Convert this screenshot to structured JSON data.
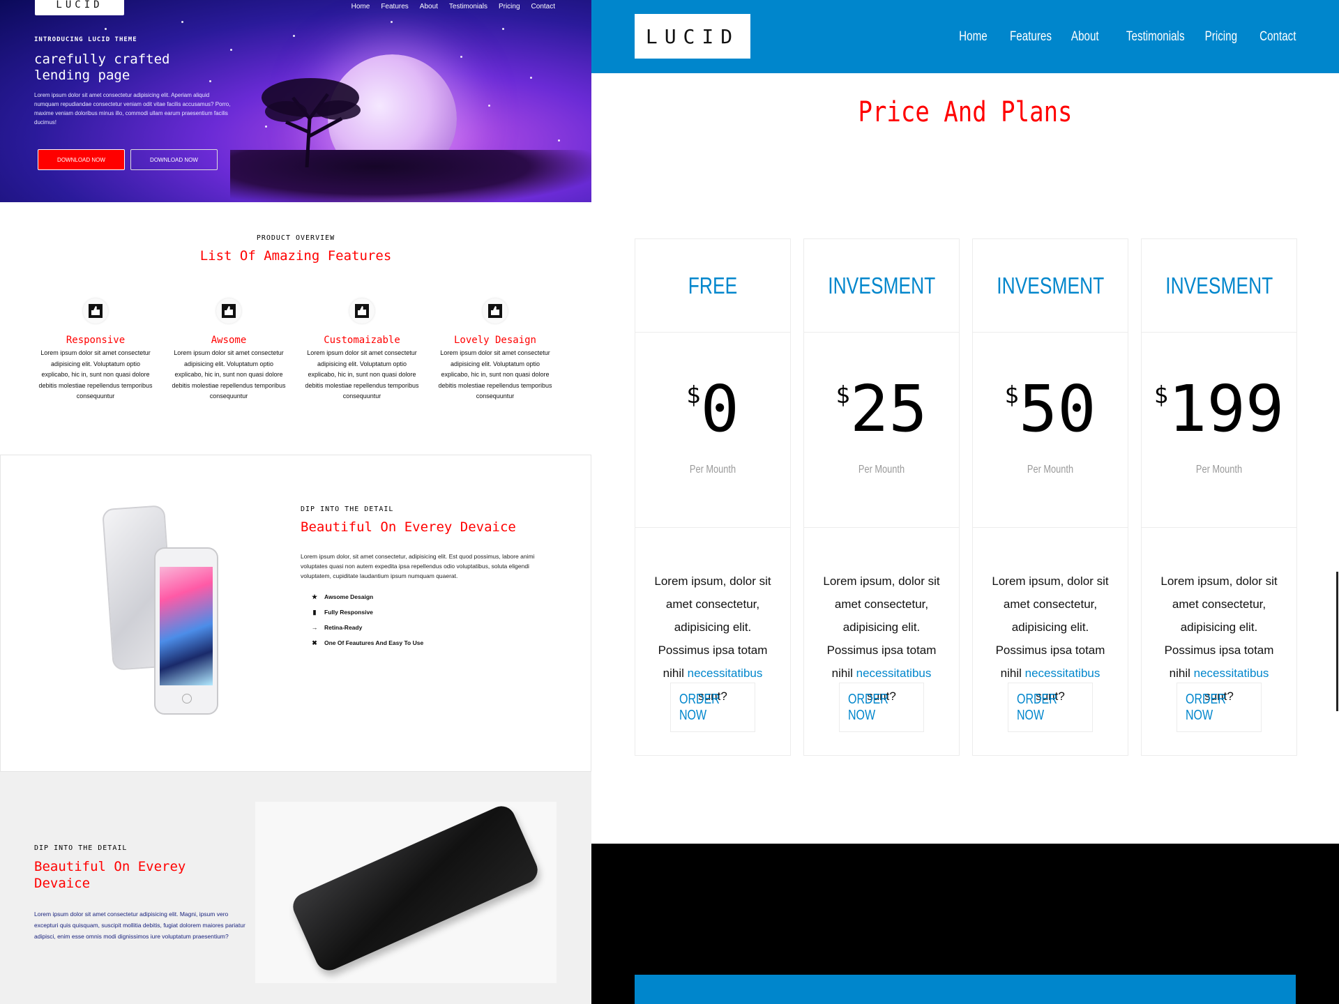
{
  "left": {
    "hero": {
      "logo": "LUCID",
      "nav": [
        "Home",
        "Features",
        "About",
        "Testimonials",
        "Pricing",
        "Contact"
      ],
      "kicker": "INTRODUCING LUCID THEME",
      "title": "carefully crafted lending page",
      "text": "Lorem ipsum dolor sit amet consectetur adipisicing elit. Aperiam aliquid numquam repudiandae consectetur veniam odit vitae facilis accusamus? Porro, maxime veniam doloribus minus illo, commodi ullam earum praesentium facilis ducimus!",
      "button1": "DOWNLOAD NOW",
      "button2": "DOWNLOAD NOW"
    },
    "features": {
      "kicker": "PRODUCT OVERVIEW",
      "title": "List Of Amazing Features",
      "items": [
        {
          "title": "Responsive",
          "text": "Lorem ipsum dolor sit amet consectetur adipisicing elit. Voluptatum optio explicabo, hic in, sunt non quasi dolore debitis molestiae repellendus temporibus consequuntur",
          "icon": "thumbs-up-icon"
        },
        {
          "title": "Awsome",
          "text": "Lorem ipsum dolor sit amet consectetur adipisicing elit. Voluptatum optio explicabo, hic in, sunt non quasi dolore debitis molestiae repellendus temporibus consequuntur",
          "icon": "thumbs-up-icon"
        },
        {
          "title": "Customaizable",
          "text": "Lorem ipsum dolor sit amet consectetur adipisicing elit. Voluptatum optio explicabo, hic in, sunt non quasi dolore debitis molestiae repellendus temporibus consequuntur",
          "icon": "thumbs-up-icon"
        },
        {
          "title": "Lovely Desaign",
          "text": "Lorem ipsum dolor sit amet consectetur adipisicing elit. Voluptatum optio explicabo, hic in, sunt non quasi dolore debitis molestiae repellendus temporibus consequuntur",
          "icon": "thumbs-up-icon"
        }
      ]
    },
    "detail": {
      "kicker": "DIP INTO THE DETAIL",
      "title": "Beautiful On Everey Devaice",
      "text": "Lorem ipsum dolor, sit amet consectetur, adipisicing elit. Est quod possimus, labore animi voluptates quasi non autem expedita ipsa repellendus odio voluptatibus, soluta eligendi voluptatem, cupiditate laudantium ipsum numquam quaerat.",
      "list": [
        {
          "label": "Awsome Desaign",
          "icon": "trophy-icon"
        },
        {
          "label": "Fully Responsive",
          "icon": "battery-icon"
        },
        {
          "label": "Retina-Ready",
          "icon": "key-icon"
        },
        {
          "label": "One Of Feautures And Easy To Use",
          "icon": "cross-arrows-icon"
        }
      ]
    },
    "detail2": {
      "kicker": "DIP INTO THE DETAIL",
      "title": "Beautiful On Everey Devaice",
      "text": "Lorem ipsum dolor sit amet consectetur adipisicing elit. Magni, ipsum vero excepturi quis quisquam, suscipit mollitia debitis, fugiat dolorem maiores pariatur adipisci, enim esse omnis modi dignissimos iure voluptatum praesentium?"
    }
  },
  "right": {
    "logo": "LUCID",
    "nav": [
      "Home",
      "Features",
      "About",
      "Testimonials",
      "Pricing",
      "Contact"
    ],
    "pricing_title": "Price And Plans",
    "plans": [
      {
        "name": "FREE",
        "currency": "$",
        "price": "0",
        "period": "Per Mounth",
        "desc_before": "Lorem ipsum, dolor sit amet consectetur, adipisicing elit. Possimus ipsa totam nihil",
        "desc_link": "necessitatibus",
        "desc_after": "sunt?",
        "button": "ORDER NOW"
      },
      {
        "name": "INVESMENT",
        "currency": "$",
        "price": "25",
        "period": "Per Mounth",
        "desc_before": "Lorem ipsum, dolor sit amet consectetur, adipisicing elit. Possimus ipsa totam nihil",
        "desc_link": "necessitatibus",
        "desc_after": "sunt?",
        "button": "ORDER NOW"
      },
      {
        "name": "INVESMENT",
        "currency": "$",
        "price": "50",
        "period": "Per Mounth",
        "desc_before": "Lorem ipsum, dolor sit amet consectetur, adipisicing elit. Possimus ipsa totam nihil",
        "desc_link": "necessitatibus",
        "desc_after": "sunt?",
        "button": "ORDER NOW"
      },
      {
        "name": "INVESMENT",
        "currency": "$",
        "price": "199",
        "period": "Per Mounth",
        "desc_before": "Lorem ipsum, dolor sit amet consectetur, adipisicing elit. Possimus ipsa totam nihil",
        "desc_link": "necessitatibus",
        "desc_after": "sunt?",
        "button": "ORDER NOW"
      }
    ]
  },
  "colors": {
    "accent_red": "#ff0000",
    "brand_blue": "#0086cc",
    "text_navy": "#1a237e"
  }
}
